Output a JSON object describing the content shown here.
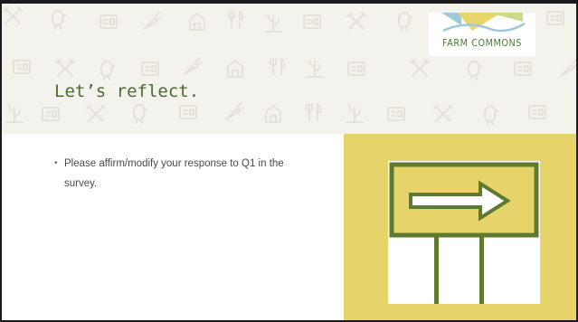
{
  "slide": {
    "title": "Let’s reflect.",
    "bullets": [
      "Please affirm/modify your response to Q1 in the survey."
    ]
  },
  "logo": {
    "text": "FARM COMMONS"
  },
  "header": {
    "pattern_icons": [
      "chicken-icon",
      "tractor-icon",
      "tools-icon",
      "barn-icon",
      "carrot-icon",
      "crop-icon",
      "id-card-icon",
      "handshake-icon"
    ]
  },
  "image": {
    "icon": "right-arrow-sign-icon"
  },
  "colors": {
    "title": "#4a6c2e",
    "header_background": "#f4f2ec",
    "panel_background": "#e6d36a",
    "sign_green": "#5e7a31",
    "logo_green": "#4f7a3a"
  }
}
